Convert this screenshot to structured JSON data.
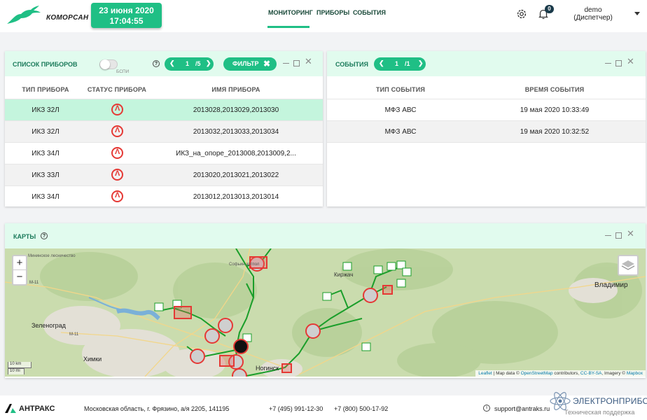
{
  "header": {
    "logo_text": "КОМОРСАН",
    "date": "23 июня 2020",
    "time": "17:04:55",
    "nav": [
      {
        "label": "МОНИТОРИНГ",
        "active": true
      },
      {
        "label": "ПРИБОРЫ",
        "active": false
      },
      {
        "label": "СОБЫТИЯ",
        "active": false
      }
    ],
    "notifications_count": "0",
    "user_name": "demo",
    "user_role": "(Диспетчер)"
  },
  "devices_panel": {
    "title": "СПИСОК ПРИБОРОВ",
    "toggle_label": "БСПИ",
    "help": "?",
    "pager": {
      "current": "1",
      "total": "/5"
    },
    "filter_label": "ФИЛЬТР",
    "columns": [
      "ТИП ПРИБОРА",
      "СТАТУС ПРИБОРА",
      "ИМЯ ПРИБОРА"
    ],
    "rows": [
      {
        "type": "ИКЗ 32Л",
        "name": "2013028,2013029,2013030"
      },
      {
        "type": "ИКЗ 32Л",
        "name": "2013032,2013033,2013034"
      },
      {
        "type": "ИКЗ 34Л",
        "name": "ИКЗ_на_опоре_2013008,2013009,2..."
      },
      {
        "type": "ИКЗ 33Л",
        "name": "2013020,2013021,2013022"
      },
      {
        "type": "ИКЗ 34Л",
        "name": "2013012,2013013,2013014"
      }
    ],
    "status_color": "#e53935"
  },
  "events_panel": {
    "title": "СОБЫТИЯ",
    "pager": {
      "current": "1",
      "total": "/1"
    },
    "columns": [
      "ТИП СОБЫТИЯ",
      "ВРЕМЯ СОБЫТИЯ"
    ],
    "rows": [
      {
        "type": "МФЗ АВС",
        "time": "19 мая 2020 10:33:49"
      },
      {
        "type": "МФЗ АВС",
        "time": "19 мая 2020 10:32:52"
      }
    ]
  },
  "map_panel": {
    "title": "КАРТЫ",
    "help": "?",
    "zoom_in": "+",
    "zoom_out": "−",
    "place_labels": [
      "Владимир",
      "Киржач",
      "Зеленоград",
      "Химки",
      "Ногинск",
      "Софьин артпол",
      "Мининское лесничество",
      "М-11",
      "М-11"
    ],
    "scale_km": "10 km",
    "scale_mi": "10 mi",
    "attribution": {
      "leaflet": "Leaflet",
      "sep1": " | Map data © ",
      "osm": "OpenStreetMap",
      "mid": " contributors, ",
      "cc": "CC-BY-SA",
      "imagery": ", Imagery © ",
      "mapbox": "Mapbox"
    }
  },
  "footer": {
    "company": "АНТРАКС",
    "address": "Московская область, г. Фрязино, а/я 2205, 141195",
    "phone1": "+7 (495) 991-12-30",
    "phone2": "+7 (800) 500-17-92",
    "email": "support@antraks.ru",
    "support_label": "Техническая поддержка",
    "watermark": "ЭЛЕКТРОНПРИБОР"
  },
  "colors": {
    "accent": "#1fbf85",
    "title_bg": "#e1fbee",
    "selected_row": "#c4f5dd",
    "status_red": "#e53935"
  }
}
